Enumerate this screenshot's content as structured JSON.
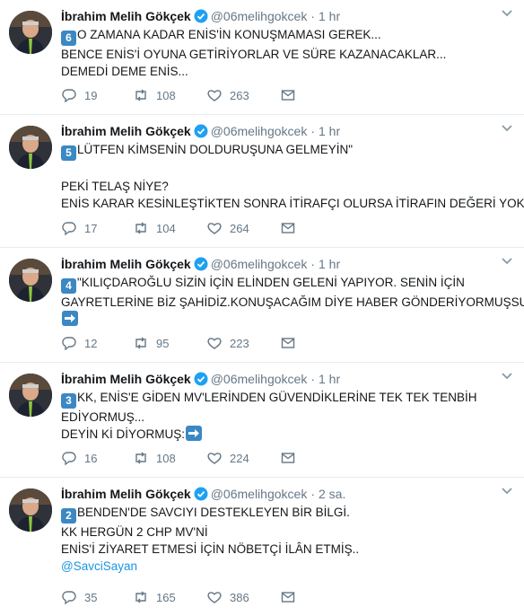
{
  "icons": {
    "reply": "reply-icon",
    "retweet": "retweet-icon",
    "like": "heart-icon",
    "dm": "envelope-icon",
    "verified": "verified-badge-icon",
    "caret": "chevron-down-icon",
    "arrow": "right-arrow-emoji-icon"
  },
  "colors": {
    "text": "#14171a",
    "muted": "#657786",
    "link": "#1b95e0",
    "divider": "#e6ecf0",
    "keycap": "#3b88c3"
  },
  "tweets": [
    {
      "name": "İbrahim Melih Gökçek",
      "handle": "@06melihgokcek",
      "time": "1 hr",
      "keycap": "6",
      "lines": [
        "O ZAMANA KADAR ENİS'İN KONUŞMAMASI GEREK...",
        "BENCE ENİS'İ OYUNA GETİRİYORLAR VE SÜRE KAZANACAKLAR...",
        "DEMEDİ DEME ENİS..."
      ],
      "replies": "19",
      "retweets": "108",
      "likes": "263"
    },
    {
      "name": "İbrahim Melih Gökçek",
      "handle": "@06melihgokcek",
      "time": "1 hr",
      "keycap": "5",
      "lines": [
        "LÜTFEN KİMSENİN DOLDURUŞUNA GELMEYİN\"",
        "",
        "PEKİ TELAŞ NİYE?",
        "ENİS KARAR KESİNLEŞTİKTEN SONRA İTİRAFÇI OLURSA İTİRAFIN DEĞERİ YOK..."
      ],
      "replies": "17",
      "retweets": "104",
      "likes": "264"
    },
    {
      "name": "İbrahim Melih Gökçek",
      "handle": "@06melihgokcek",
      "time": "1 hr",
      "keycap": "4",
      "lines": [
        "\"KILIÇDAROĞLU SİZİN İÇİN ELİNDEN GELENİ YAPIYOR. SENİN İÇİN",
        "GAYRETLERİNE BİZ ŞAHİDİZ.KONUŞACAĞIM DİYE HABER GÖNDERİYORMUŞSUN"
      ],
      "replies": "12",
      "retweets": "95",
      "likes": "223"
    },
    {
      "name": "İbrahim Melih Gökçek",
      "handle": "@06melihgokcek",
      "time": "1 hr",
      "keycap": "3",
      "lines": [
        "KK, ENİS'E GİDEN MV'LERİNDEN GÜVENDİKLERİNE TEK TEK TENBİH",
        "EDİYORMUŞ...",
        "DEYİN Kİ DİYORMUŞ:"
      ],
      "replies": "16",
      "retweets": "108",
      "likes": "224"
    },
    {
      "name": "İbrahim Melih Gökçek",
      "handle": "@06melihgokcek",
      "time": "2 sa.",
      "keycap": "2",
      "lines": [
        "BENDEN'DE SAVCIYI DESTEKLEYEN BİR BİLGİ.",
        "KK HERGÜN 2 CHP MV'Nİ",
        "ENİS'İ ZİYARET ETMESİ İÇİN NÖBETÇİ İLÂN ETMİŞ.."
      ],
      "mention": "@SavciSayan",
      "replies": "35",
      "retweets": "165",
      "likes": "386"
    }
  ]
}
